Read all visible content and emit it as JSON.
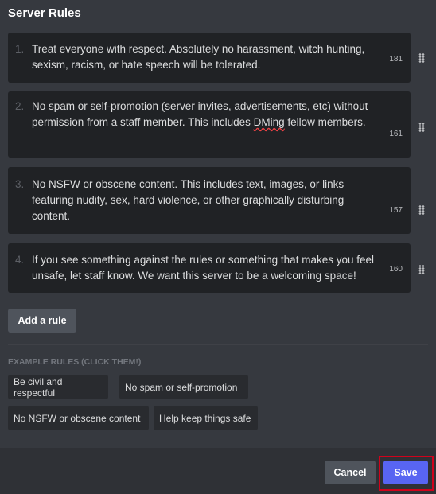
{
  "title": "Server Rules",
  "rules": [
    {
      "num": "1.",
      "text": "Treat everyone with respect. Absolutely no harassment, witch hunting, sexism, racism, or hate speech will be tolerated.",
      "count": "181"
    },
    {
      "num": "2.",
      "text_a": "No spam or self-promotion (server invites, advertisements, etc) without permission from a staff member. This includes ",
      "text_sp": "DMing",
      "text_b": " fellow members.",
      "count": "161"
    },
    {
      "num": "3.",
      "text": "No NSFW or obscene content. This includes text, images, or links featuring nudity, sex, hard violence, or other graphically disturbing content.",
      "count": "157"
    },
    {
      "num": "4.",
      "text": "If you see something against the rules or something that makes you feel unsafe, let staff know. We want this server to be a welcoming space!",
      "count": "160"
    }
  ],
  "add_rule": "Add a rule",
  "examples_label": "EXAMPLE RULES (CLICK THEM!)",
  "examples": [
    "Be civil and respectful",
    "No spam or self-promotion",
    "No NSFW or obscene content",
    "Help keep things safe"
  ],
  "footer": {
    "cancel": "Cancel",
    "save": "Save"
  },
  "colors": {
    "accent": "#5865f2",
    "highlight": "#d0021b"
  }
}
